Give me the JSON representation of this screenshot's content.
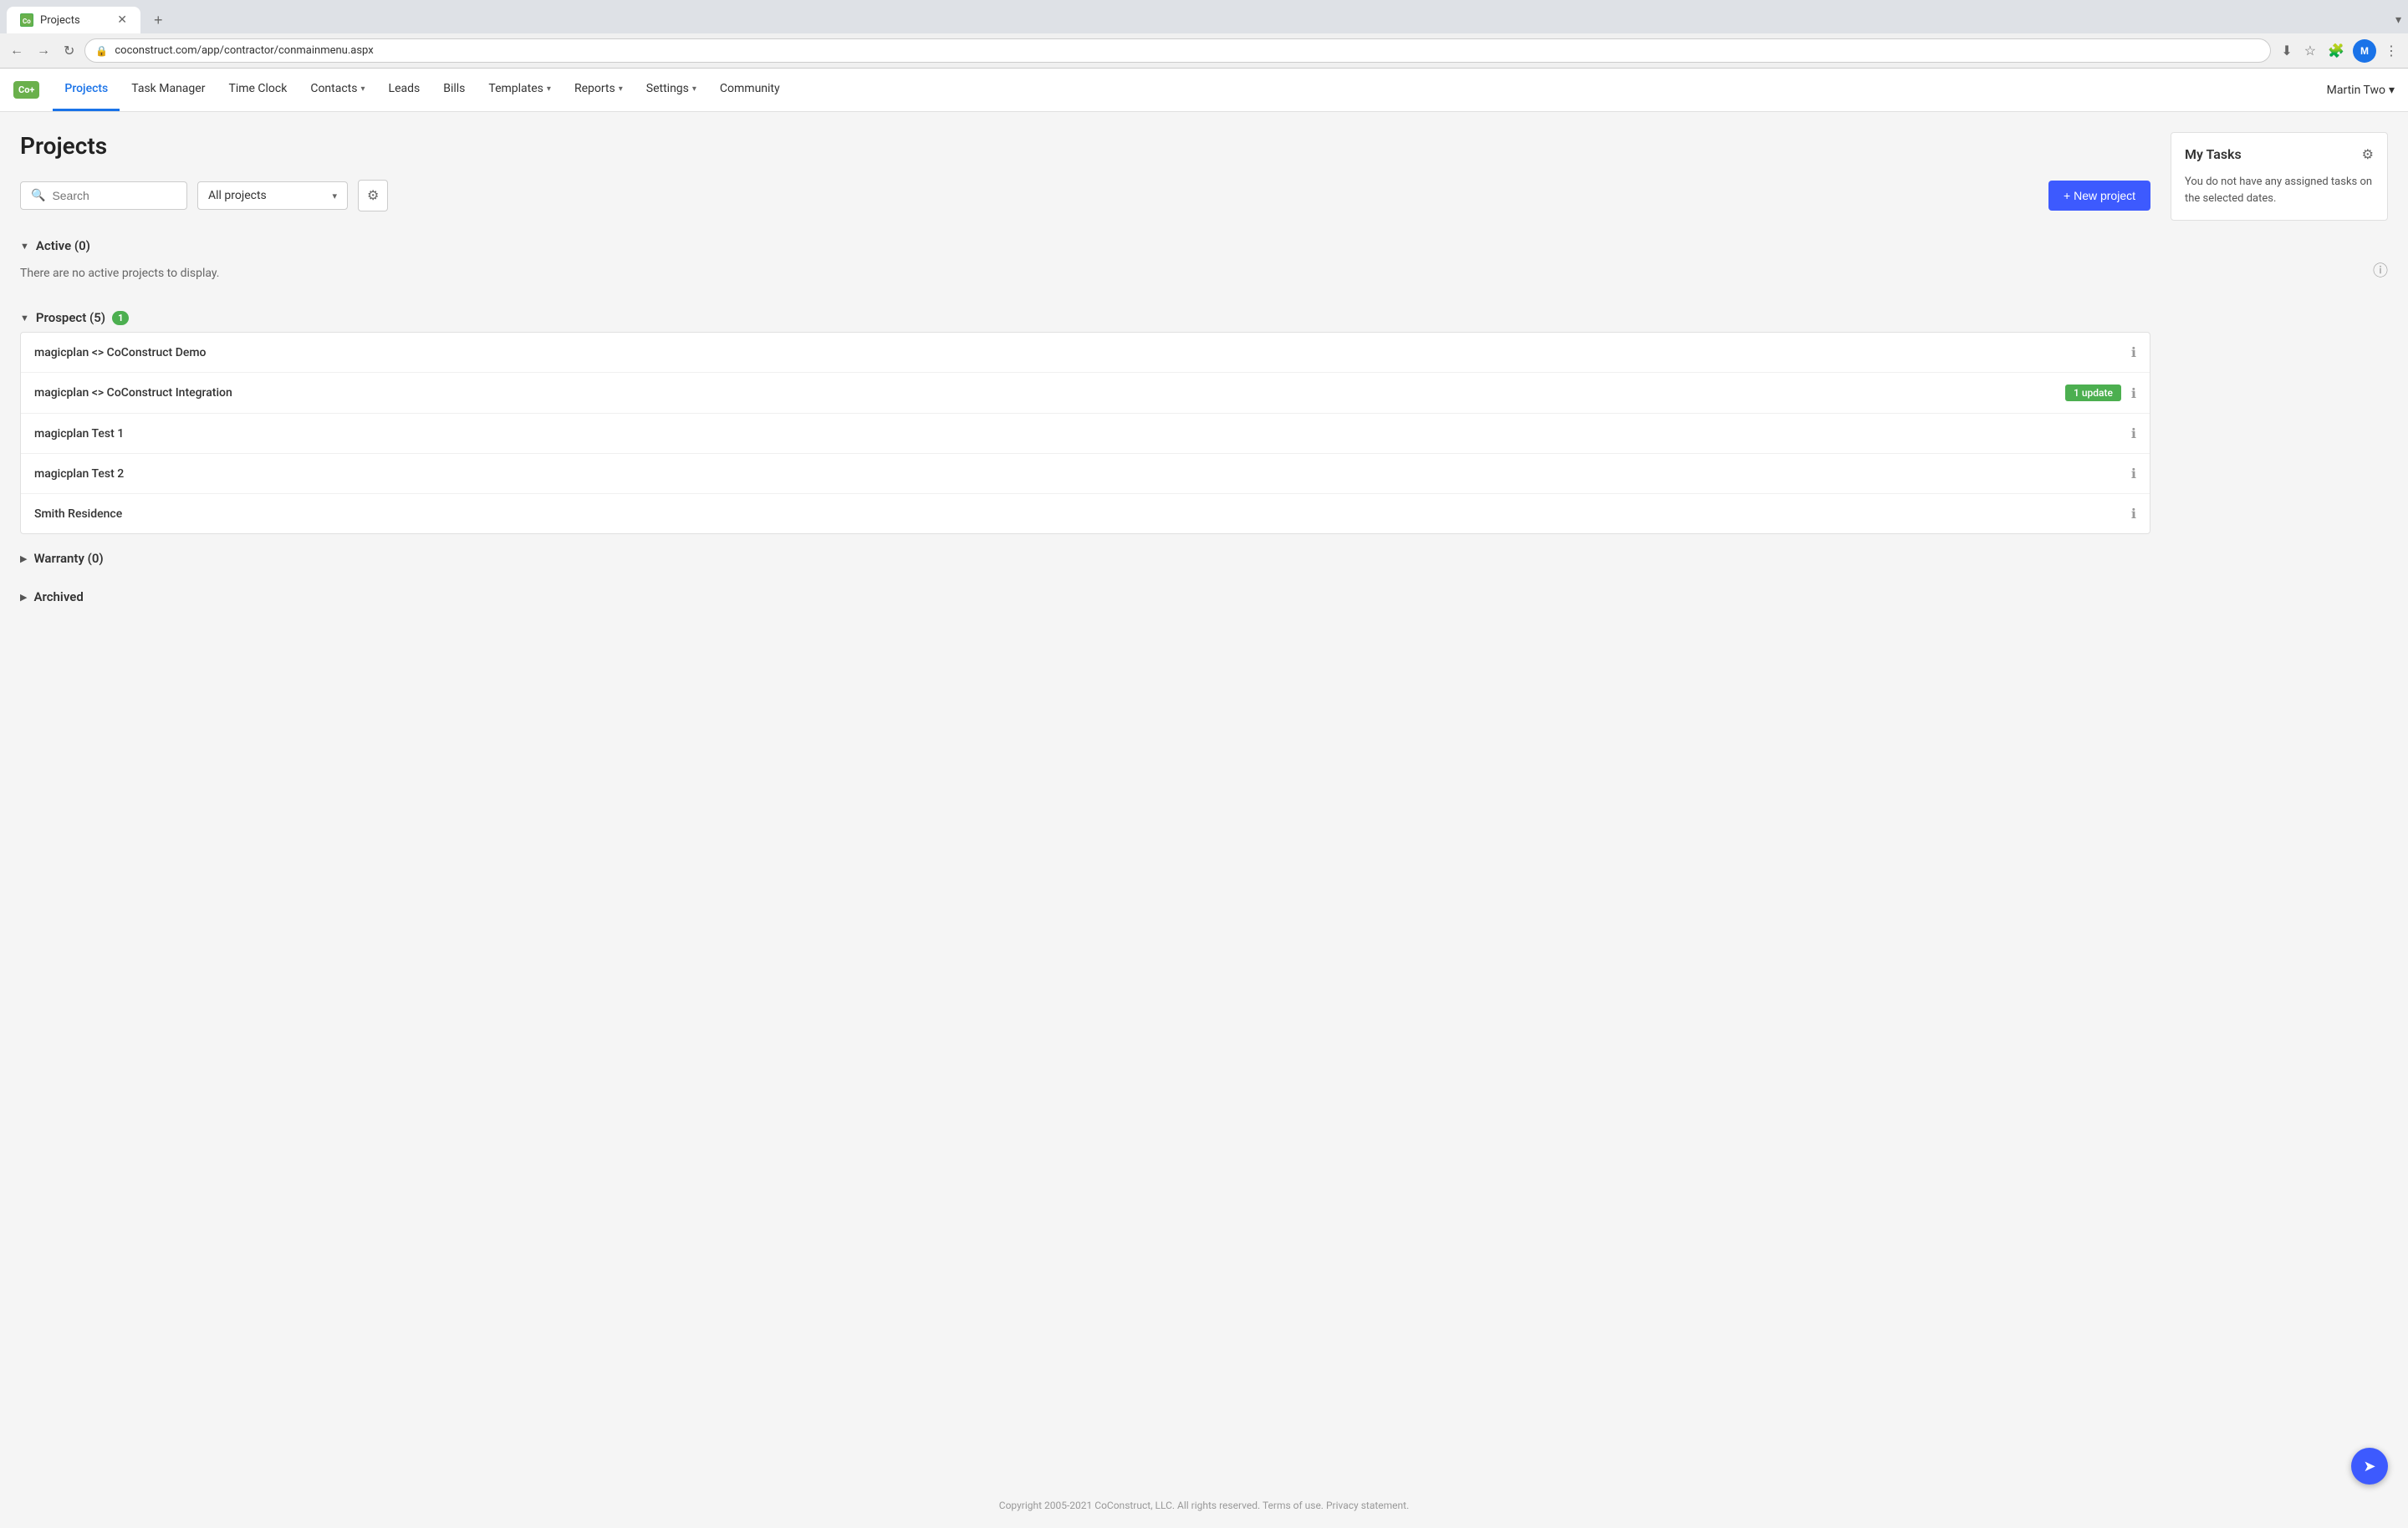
{
  "browser": {
    "tab_title": "Projects",
    "tab_new_label": "+",
    "tab_dropdown": "▾",
    "favicon_text": "Co",
    "url": "coconstruct.com/app/contractor/conmainmenu.aspx",
    "lock_symbol": "🔒",
    "back_btn": "←",
    "forward_btn": "→",
    "reload_btn": "↻",
    "user_avatar": "M"
  },
  "nav": {
    "logo": "Co+",
    "items": [
      {
        "label": "Projects",
        "active": true,
        "has_dropdown": false
      },
      {
        "label": "Task Manager",
        "active": false,
        "has_dropdown": false
      },
      {
        "label": "Time Clock",
        "active": false,
        "has_dropdown": false
      },
      {
        "label": "Contacts",
        "active": false,
        "has_dropdown": true
      },
      {
        "label": "Leads",
        "active": false,
        "has_dropdown": false
      },
      {
        "label": "Bills",
        "active": false,
        "has_dropdown": false
      },
      {
        "label": "Templates",
        "active": false,
        "has_dropdown": true
      },
      {
        "label": "Reports",
        "active": false,
        "has_dropdown": true
      },
      {
        "label": "Settings",
        "active": false,
        "has_dropdown": true
      },
      {
        "label": "Community",
        "active": false,
        "has_dropdown": false
      }
    ],
    "user_name": "Martin Two",
    "user_chevron": "▾"
  },
  "page": {
    "title": "Projects",
    "help_symbol": "ⓘ"
  },
  "toolbar": {
    "search_placeholder": "Search",
    "filter_label": "All projects",
    "gear_symbol": "⚙",
    "new_project_label": "+ New project"
  },
  "sections": [
    {
      "name": "active",
      "title": "Active (0)",
      "expanded": true,
      "badge": null,
      "empty_message": "There are no active projects to display.",
      "projects": []
    },
    {
      "name": "prospect",
      "title": "Prospect (5)",
      "expanded": true,
      "badge": "1",
      "empty_message": null,
      "projects": [
        {
          "name": "magicplan <> CoConstruct Demo",
          "update": null
        },
        {
          "name": "magicplan <> CoConstruct Integration",
          "update": "1 update"
        },
        {
          "name": "magicplan Test 1",
          "update": null
        },
        {
          "name": "magicplan Test 2",
          "update": null
        },
        {
          "name": "Smith Residence",
          "update": null
        }
      ]
    },
    {
      "name": "warranty",
      "title": "Warranty (0)",
      "expanded": false,
      "badge": null,
      "empty_message": null,
      "projects": []
    },
    {
      "name": "archived",
      "title": "Archived",
      "expanded": false,
      "badge": null,
      "empty_message": null,
      "projects": []
    }
  ],
  "my_tasks": {
    "title": "My Tasks",
    "empty_message": "You do not have any assigned tasks on the selected dates.",
    "gear_symbol": "⚙"
  },
  "footer": {
    "copyright": "Copyright 2005-2021 CoConstruct, LLC. All rights reserved.",
    "terms_label": "Terms of use.",
    "privacy_label": "Privacy statement."
  },
  "nav_arrow": "➤"
}
